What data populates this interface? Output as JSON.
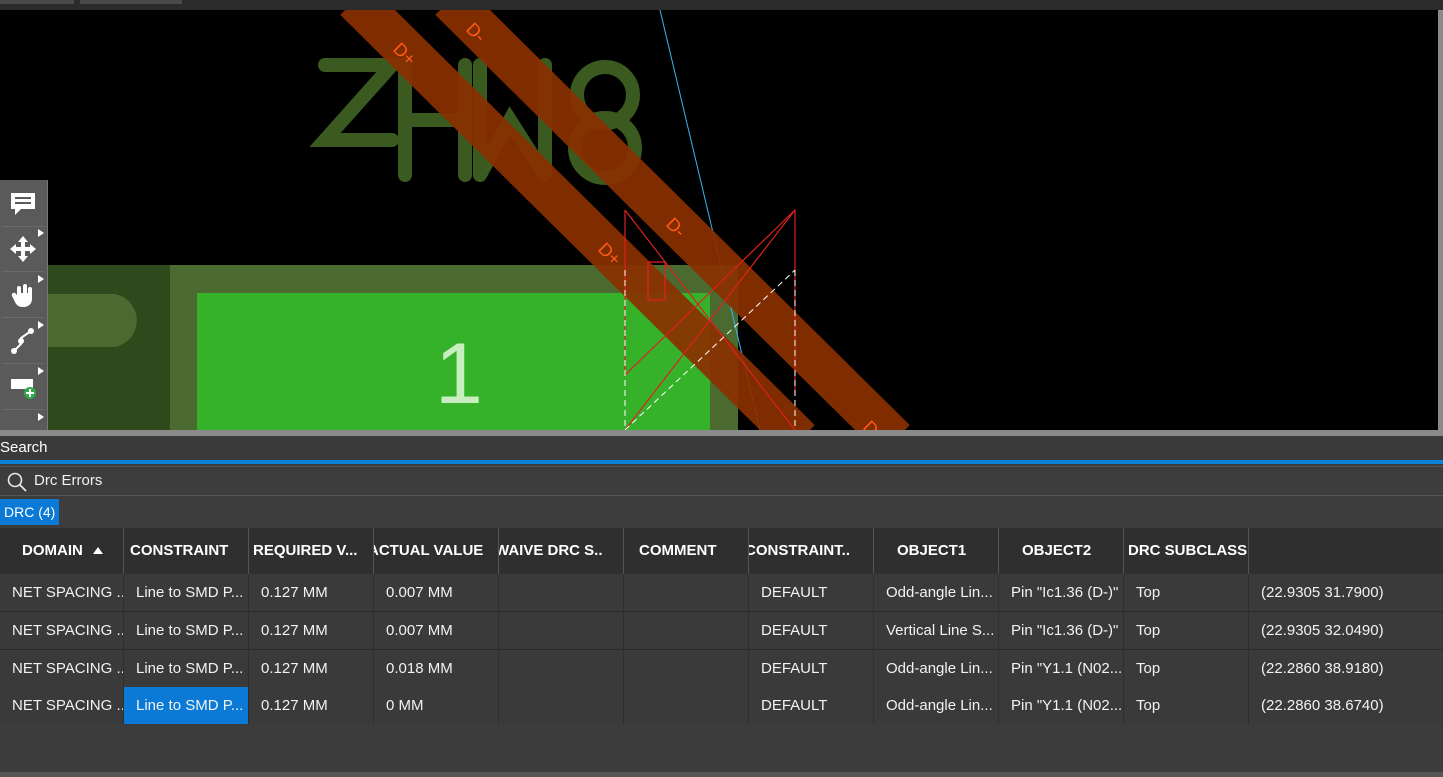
{
  "canvas": {
    "silkscreen_text": "ZHW8",
    "pad_number": "1",
    "net_labels": [
      "D-",
      "D+",
      "D-",
      "D+",
      "D"
    ],
    "colors": {
      "background": "#000000",
      "trace": "#8a3000",
      "pad": "#35b22a",
      "silk": "#3a5a20"
    }
  },
  "toolbar": {
    "tools": [
      {
        "icon": "comment-icon"
      },
      {
        "icon": "move-icon"
      },
      {
        "icon": "hand-pointer-icon"
      },
      {
        "icon": "route-icon"
      },
      {
        "icon": "add-shape-icon"
      }
    ]
  },
  "panel": {
    "title": "Search",
    "search_value": "Drc Errors",
    "tab_label": "DRC (4)"
  },
  "table": {
    "headers": [
      "DOMAIN",
      "CONSTRAINT",
      "REQUIRED V...",
      "ACTUAL VALUE",
      "WAIVE DRC S..",
      "COMMENT",
      "CONSTRAINT..",
      "OBJECT1",
      "OBJECT2",
      "DRC SUBCLASS",
      ""
    ],
    "rows": [
      [
        "NET SPACING ...",
        "Line to SMD P...",
        "0.127 MM",
        "0.007 MM",
        "",
        "",
        "DEFAULT",
        "Odd-angle Lin...",
        "Pin \"Ic1.36 (D-)\"",
        "Top",
        "(22.9305 31.7900)"
      ],
      [
        "NET SPACING ...",
        "Line to SMD P...",
        "0.127 MM",
        "0.007 MM",
        "",
        "",
        "DEFAULT",
        "Vertical Line S...",
        "Pin \"Ic1.36 (D-)\"",
        "Top",
        "(22.9305 32.0490)"
      ],
      [
        "NET SPACING ...",
        "Line to SMD P...",
        "0.127 MM",
        "0.018 MM",
        "",
        "",
        "DEFAULT",
        "Odd-angle Lin...",
        "Pin \"Y1.1 (N02...",
        "Top",
        "(22.2860 38.9180)"
      ],
      [
        "NET SPACING ...",
        "Line to SMD P...",
        "0.127 MM",
        "0 MM",
        "",
        "",
        "DEFAULT",
        "Odd-angle Lin...",
        "Pin \"Y1.1 (N02...",
        "Top",
        "(22.2860 38.6740)"
      ]
    ],
    "selected_cell": {
      "row": 4,
      "column": 2
    },
    "accent_color": "#0a7ad6"
  }
}
